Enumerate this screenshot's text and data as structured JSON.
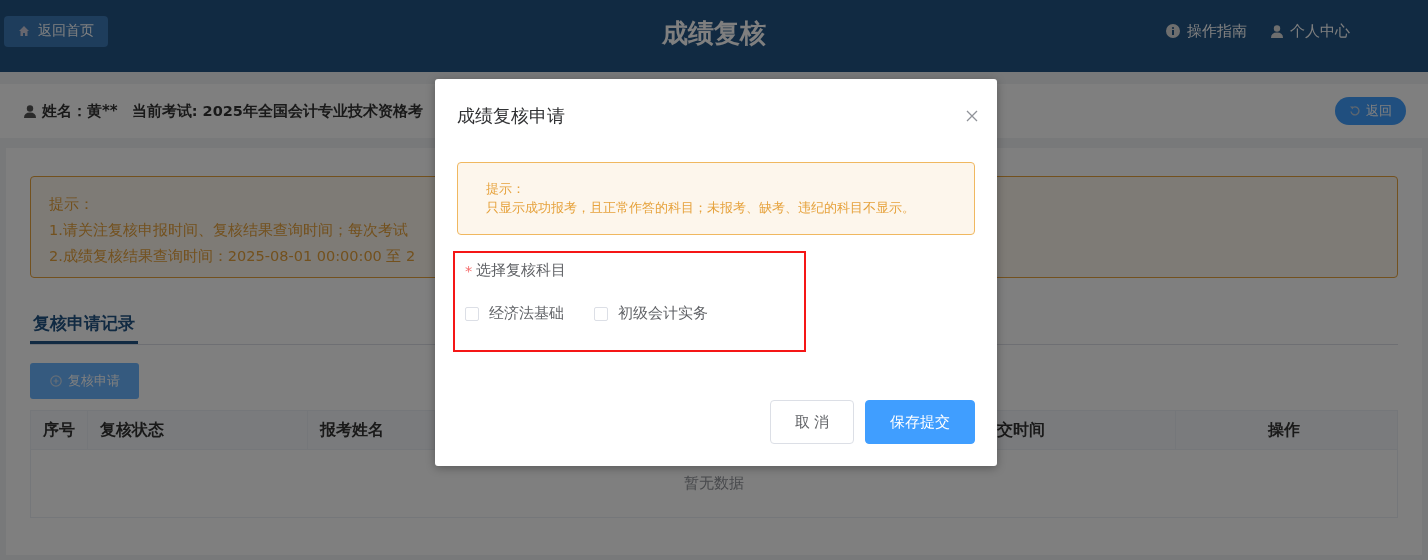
{
  "header": {
    "home_button": "返回首页",
    "title": "成绩复核",
    "links": [
      {
        "label": "操作指南",
        "kind": "guide"
      },
      {
        "label": "个人中心",
        "kind": "user"
      }
    ]
  },
  "info_bar": {
    "name": "姓名：黄**",
    "exam": "当前考试: 2025年全国会计专业技术资格考",
    "back_button": "返回"
  },
  "notice": {
    "title": "提示：",
    "lines": [
      "1.请关注复核申报时间、复核结果查询时间；每次考试",
      "2.成绩复核结果查询时间：2025-08-01 00:00:00 至 2"
    ]
  },
  "tabs": [
    {
      "label": "复核申请记录",
      "selected": true
    }
  ],
  "apply_button": "复核申请",
  "table": {
    "columns": [
      "序号",
      "复核状态",
      "报考姓名",
      "",
      "交时间",
      "操作"
    ],
    "empty_text": "暂无数据"
  },
  "dialog": {
    "title": "成绩复核申请",
    "alert": {
      "title": "提示：",
      "text": "只显示成功报考，且正常作答的科目；未报考、缺考、违纪的科目不显示。"
    },
    "field": {
      "label": "选择复核科目",
      "required": true,
      "required_mark": "*",
      "options": [
        {
          "label": "经济法基础",
          "checked": false
        },
        {
          "label": "初级会计实务",
          "checked": false
        }
      ]
    },
    "buttons": [
      {
        "label": "取 消",
        "kind": "default"
      },
      {
        "label": "保存提交",
        "kind": "primary"
      }
    ]
  }
}
